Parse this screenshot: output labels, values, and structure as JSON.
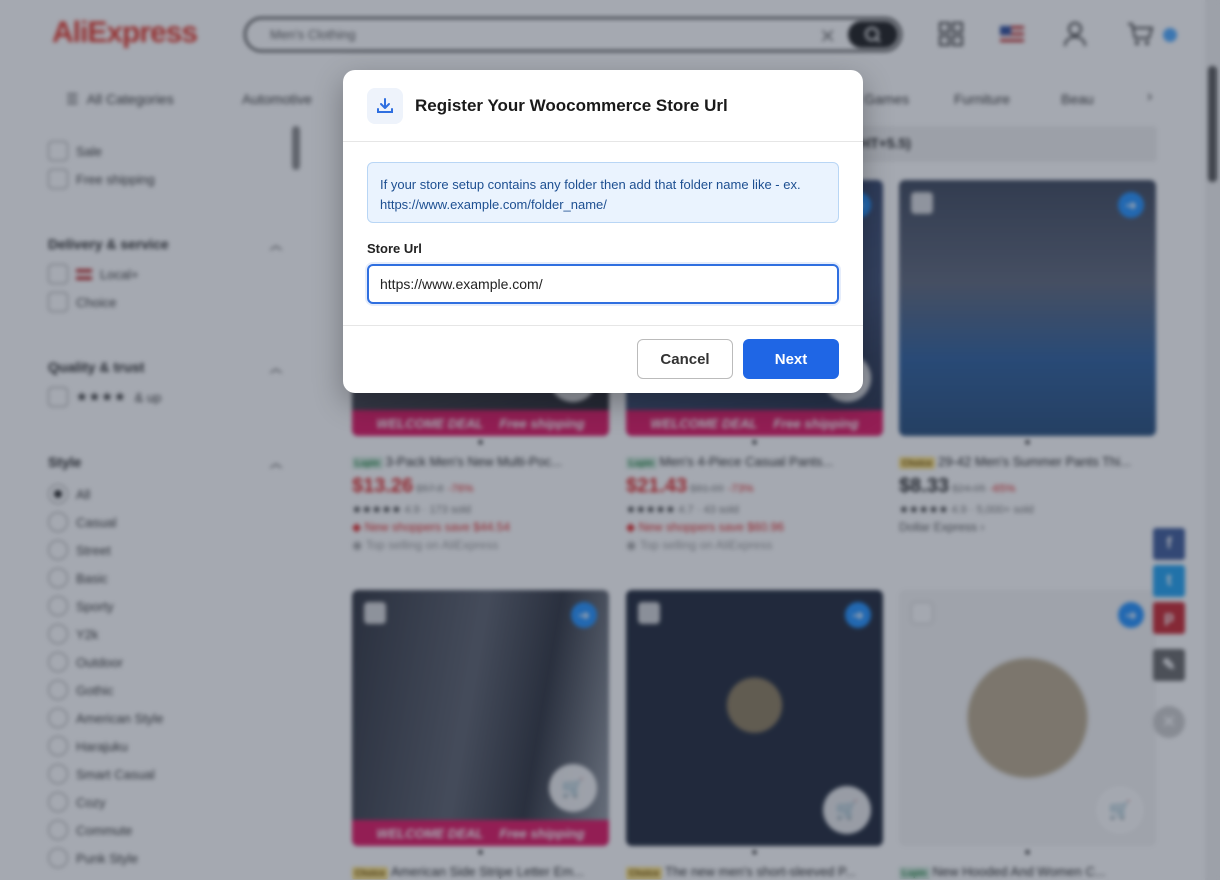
{
  "header": {
    "logo": "AliExpress",
    "search_value": "Men's Clothing"
  },
  "nav": {
    "items": [
      "All Categories",
      "Automotive",
      "Games",
      "Furniture",
      "Beau"
    ],
    "more": "›"
  },
  "sidebar": {
    "top_options": [
      "Sale",
      "Free shipping"
    ],
    "delivery": {
      "title": "Delivery & service",
      "options": [
        "Local+",
        "Choice"
      ]
    },
    "quality": {
      "title": "Quality & trust",
      "stars": "★★★★",
      "suffix": "& up"
    },
    "style": {
      "title": "Style",
      "options": [
        "All",
        "Casual",
        "Street",
        "Basic",
        "Sporty",
        "Y2k",
        "Outdoor",
        "Gothic",
        "American Style",
        "Harajuku",
        "Smart Casual",
        "Cozy",
        "Commute",
        "Punk Style"
      ]
    }
  },
  "banner": {
    "text": "HT+5.5)"
  },
  "deal": {
    "welcome": "WELCOME DEAL",
    "free": "Free shipping"
  },
  "products": [
    {
      "tag": "Lupin",
      "title": "3-Pack Men's New Multi-Poc...",
      "price": "$13.26",
      "old": "$57.8",
      "off": "-76%",
      "rating": "4.9 · 173 sold",
      "promo": "New shoppers save $44.54",
      "top": "Top selling on AliExpress"
    },
    {
      "tag": "Lupin",
      "title": "Men's 4-Piece Casual Pants...",
      "price": "$21.43",
      "old": "$81.09",
      "off": "-73%",
      "rating": "4.7 · 43 sold",
      "promo": "New shoppers save $60.96",
      "top": "Top selling on AliExpress"
    },
    {
      "tag": "Choice",
      "title": "29-42 Men's Summer Pants Thi...",
      "price": "$8.33",
      "old": "$24.05",
      "off": "-65%",
      "rating": "4.9 · 5,000+ sold",
      "store": "Dollar Express ›"
    },
    {
      "tag": "Choice",
      "title": "American Side Stripe Letter Em..."
    },
    {
      "tag": "Choice",
      "title": "The new men's short-sleeved P..."
    },
    {
      "tag": "Lupin",
      "title": "New Hooded And Women C..."
    }
  ],
  "modal": {
    "title": "Register Your Woocommerce Store Url",
    "info_line1": "If your store setup contains any folder then add that folder name like - ex.",
    "info_line2": "https://www.example.com/folder_name/",
    "field_label": "Store Url",
    "field_value": "https://www.example.com/",
    "cancel": "Cancel",
    "next": "Next"
  },
  "colors": {
    "accent": "#1f66e5",
    "info_bg": "#eaf3fe",
    "deal": "#e0115f",
    "price": "#e02020"
  }
}
